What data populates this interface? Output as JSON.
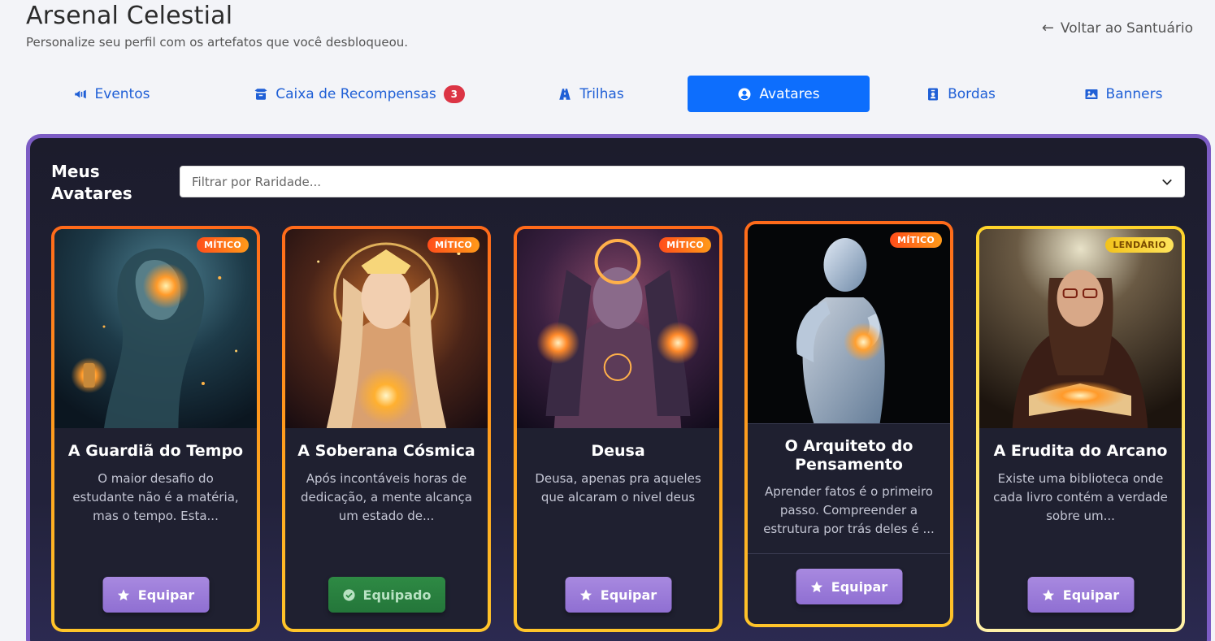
{
  "header": {
    "title": "Arsenal Celestial",
    "subtitle": "Personalize seu perfil com os artefatos que você desbloqueou.",
    "back_label": "Voltar ao Santuário"
  },
  "tabs": [
    {
      "label": "Eventos",
      "icon": "megaphone-icon",
      "active": false
    },
    {
      "label": "Caixa de Recompensas",
      "icon": "box-icon",
      "badge": "3",
      "active": false
    },
    {
      "label": "Trilhas",
      "icon": "road-icon",
      "active": false
    },
    {
      "label": "Avatares",
      "icon": "user-circle-icon",
      "active": true
    },
    {
      "label": "Bordas",
      "icon": "id-badge-icon",
      "active": false
    },
    {
      "label": "Banners",
      "icon": "image-icon",
      "active": false
    }
  ],
  "panel": {
    "title": "Meus Avatares",
    "filter_placeholder": "Filtrar por Raridade..."
  },
  "cards": [
    {
      "name": "A Guardiã do Tempo",
      "rarity": "MÍTICO",
      "description": "O maior desafio do estudante não é a matéria, mas o tempo. Esta...",
      "button": "Equipar",
      "equipped": false
    },
    {
      "name": "A Soberana Cósmica",
      "rarity": "MÍTICO",
      "description": "Após incontáveis horas de dedicação, a mente alcança um estado de...",
      "button": "Equipado",
      "equipped": true
    },
    {
      "name": "Deusa",
      "rarity": "MÍTICO",
      "description": "Deusa, apenas pra aqueles que alcaram o nivel deus",
      "button": "Equipar",
      "equipped": false
    },
    {
      "name": "O Arquiteto do Pensamento",
      "rarity": "MÍTICO",
      "description": "Aprender fatos é o primeiro passo. Compreender a estrutura por trás deles é ...",
      "button": "Equipar",
      "equipped": false
    },
    {
      "name": "A Erudita do Arcano",
      "rarity": "LENDÁRIO",
      "description": "Existe uma biblioteca onde cada livro contém a verdade sobre um...",
      "button": "Equipar",
      "equipped": false
    }
  ],
  "colors": {
    "accent": "#0d6efd",
    "panel_border": "#7c5cc4",
    "mythic": "#ff7a1a",
    "legendary": "#ffd42a",
    "equip_button": "#9b7cdb",
    "equipped_button": "#2e8a44"
  }
}
